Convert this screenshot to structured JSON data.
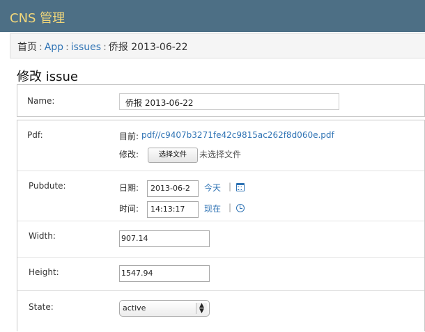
{
  "header": {
    "brand": "CNS 管理"
  },
  "breadcrumb": {
    "home": "首页",
    "sep1": ":",
    "app": "App",
    "sep2": ":",
    "issues": "issues",
    "sep3": ":",
    "current": "侨报 2013-06-22"
  },
  "form": {
    "title": "修改 issue",
    "name": {
      "label": "Name:",
      "value": "侨报 2013-06-22"
    },
    "pdf": {
      "label": "Pdf:",
      "current_label": "目前:",
      "current_link": "pdf//c9407b3271fe42c9815ac262f8d060e.pdf",
      "change_label": "修改:",
      "choose_button": "选择文件",
      "no_file": "未选择文件"
    },
    "pubdute": {
      "label": "Pubdute:",
      "date_label": "日期:",
      "date_value": "2013-06-2",
      "today": "今天",
      "bar1": "|",
      "time_label": "时间:",
      "time_value": "14:13:17",
      "now": "现在",
      "bar2": "|"
    },
    "width": {
      "label": "Width:",
      "value": "907.14"
    },
    "height": {
      "label": "Height:",
      "value": "1547.94"
    },
    "state": {
      "label": "State:",
      "value": "active"
    }
  },
  "colors": {
    "header_bg": "#4d6f85",
    "brand": "#f2d77a",
    "link": "#2f73b4"
  }
}
